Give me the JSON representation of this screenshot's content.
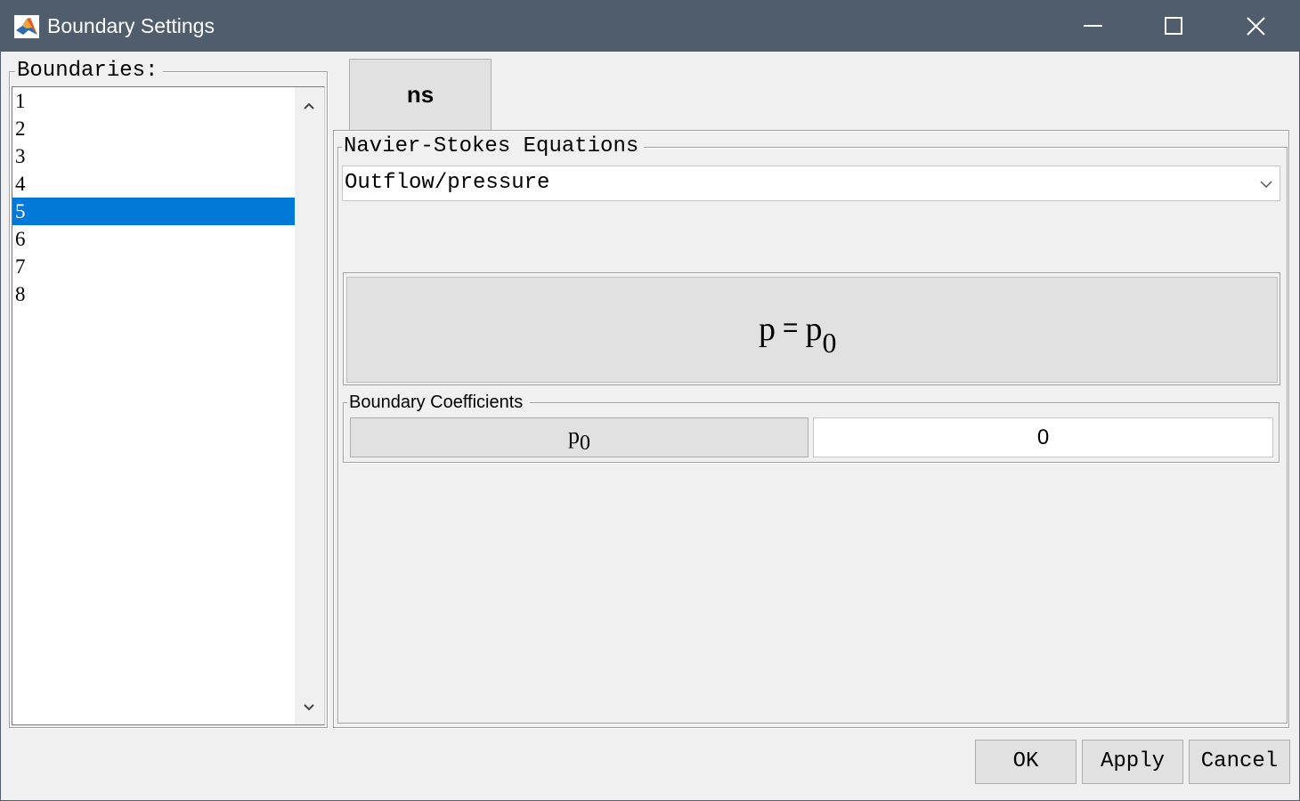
{
  "window": {
    "title": "Boundary Settings",
    "icon": "matlab-icon",
    "controls": [
      "minimize-icon",
      "maximize-icon",
      "close-icon"
    ]
  },
  "boundaries": {
    "label": "Boundaries:",
    "items": [
      "1",
      "2",
      "3",
      "4",
      "5",
      "6",
      "7",
      "8"
    ],
    "selected": "5"
  },
  "tabs": [
    {
      "label": "ns"
    }
  ],
  "navier_stokes": {
    "group_label": "Navier-Stokes Equations",
    "condition_type": "Outflow/pressure",
    "equation": {
      "lhs": "p",
      "operator": "=",
      "rhs_base": "p",
      "rhs_sub": "0"
    }
  },
  "coefficients": {
    "group_label": "Boundary Coefficients",
    "rows": [
      {
        "symbol": "p",
        "subscript": "0",
        "value": "0"
      }
    ]
  },
  "buttons": {
    "ok": "OK",
    "apply": "Apply",
    "cancel": "Cancel"
  },
  "colors": {
    "titlebar": "#505d6d",
    "selection": "#0078d7",
    "background": "#f0f0f0"
  }
}
